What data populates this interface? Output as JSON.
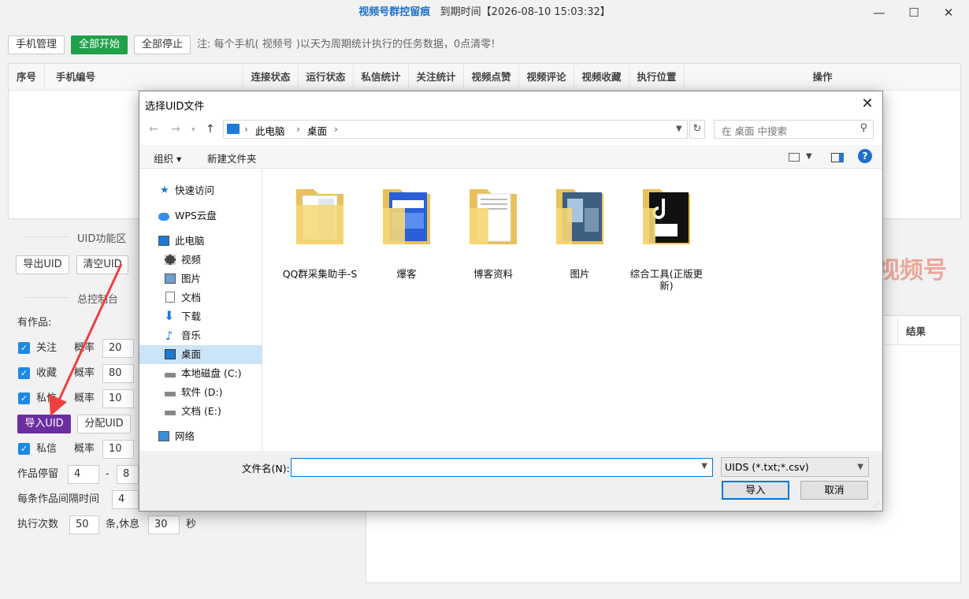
{
  "window": {
    "app_name": "视频号群控留痕",
    "expiry": "到期时间【2026-08-10 15:03:32】",
    "minimize": "—",
    "maximize": "☐",
    "close": "✕"
  },
  "toolbar": {
    "phone_manage": "手机管理",
    "start_all": "全部开始",
    "stop_all": "全部停止",
    "note": "注: 每个手机( 视频号 )以天为周期统计执行的任务数据，0点清零!"
  },
  "table": {
    "headers": [
      "序号",
      "手机编号",
      "连接状态",
      "运行状态",
      "私信统计",
      "关注统计",
      "视频点赞",
      "视频评论",
      "视频收藏",
      "执行位置",
      "操作"
    ]
  },
  "uid_section": {
    "title": "UID功能区",
    "export": "导出UID",
    "clear": "清空UID"
  },
  "console": {
    "title": "总控制台",
    "has_works": "有作品:",
    "rows": [
      {
        "label": "关注",
        "prob_label": "概率",
        "value": "20"
      },
      {
        "label": "收藏",
        "prob_label": "概率",
        "value": "80"
      },
      {
        "label": "私信",
        "prob_label": "概率",
        "value": "10"
      }
    ],
    "import_uid": "导入UID",
    "assign_uid": "分配UID",
    "dm_label": "私信",
    "dm_prob_label": "概率",
    "dm_value": "10",
    "stay_label": "作品停留",
    "stay_min": "4",
    "stay_dash": "-",
    "stay_max": "8",
    "interval_label": "每条作品间隔时间",
    "interval_value": "4",
    "exec_label": "执行次数",
    "exec_count": "50",
    "exec_unit": "条,休息",
    "rest_value": "30",
    "rest_unit": "秒"
  },
  "right_panel": {
    "result_header": "结果",
    "watermark": "视频号"
  },
  "dialog": {
    "title": "选择UID文件",
    "close": "✕",
    "path": [
      "此电脑",
      "桌面"
    ],
    "search_placeholder": "在 桌面 中搜索",
    "organize": "组织 ▾",
    "new_folder": "新建文件夹",
    "nav": [
      {
        "label": "快速访问",
        "icon": "star-icon"
      },
      {
        "label": "WPS云盘",
        "icon": "cloud-icon"
      },
      {
        "label": "此电脑",
        "icon": "computer-icon"
      },
      {
        "label": "视频",
        "icon": "video-icon"
      },
      {
        "label": "图片",
        "icon": "picture-icon"
      },
      {
        "label": "文档",
        "icon": "document-icon"
      },
      {
        "label": "下载",
        "icon": "download-icon"
      },
      {
        "label": "音乐",
        "icon": "music-icon"
      },
      {
        "label": "桌面",
        "icon": "desktop-icon"
      },
      {
        "label": "本地磁盘 (C:)",
        "icon": "drive-icon"
      },
      {
        "label": "软件 (D:)",
        "icon": "drive-icon"
      },
      {
        "label": "文档 (E:)",
        "icon": "drive-icon"
      },
      {
        "label": "网络",
        "icon": "network-icon"
      }
    ],
    "files": [
      {
        "name": "QQ群采集助手-S",
        "icon": "folder-icon"
      },
      {
        "name": "爆客",
        "icon": "folder-icon"
      },
      {
        "name": "博客资料",
        "icon": "folder-icon"
      },
      {
        "name": "图片",
        "icon": "folder-icon"
      },
      {
        "name": "综合工具(正版更新)",
        "icon": "folder-icon"
      }
    ],
    "filename_label": "文件名(N):",
    "filename_value": "",
    "filetype": "UIDS (*.txt;*.csv)",
    "import_button": "导入",
    "cancel_button": "取消"
  }
}
